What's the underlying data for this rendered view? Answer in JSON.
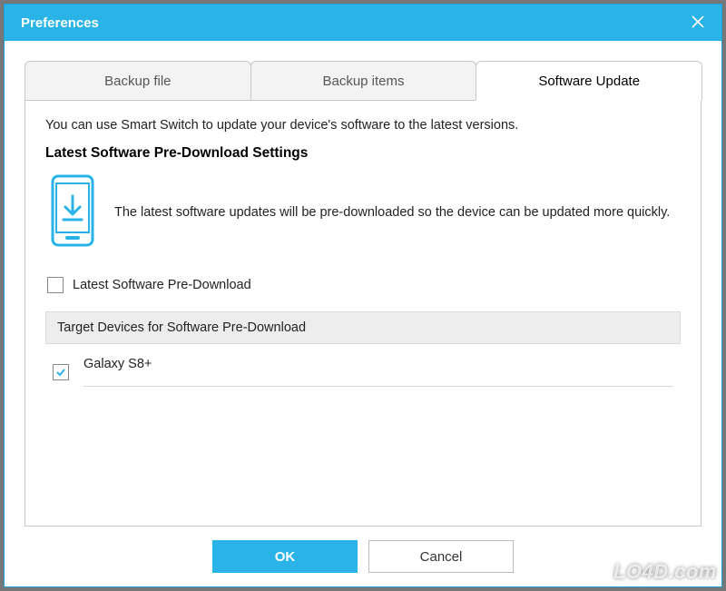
{
  "window": {
    "title": "Preferences"
  },
  "tabs": [
    {
      "label": "Backup file",
      "active": false
    },
    {
      "label": "Backup items",
      "active": false
    },
    {
      "label": "Software Update",
      "active": true
    }
  ],
  "content": {
    "intro": "You can use Smart Switch to update your device's software to the latest versions.",
    "heading": "Latest Software Pre-Download Settings",
    "description": "The latest software updates will be pre-downloaded so the device can be updated more quickly.",
    "predownload_checkbox_label": "Latest Software Pre-Download",
    "predownload_checked": false,
    "target_section_header": "Target Devices for Software Pre-Download",
    "devices": [
      {
        "name": "Galaxy S8+",
        "checked": true
      }
    ]
  },
  "footer": {
    "ok": "OK",
    "cancel": "Cancel"
  },
  "watermark": "LO4D.com",
  "colors": {
    "accent": "#29b3e6"
  }
}
